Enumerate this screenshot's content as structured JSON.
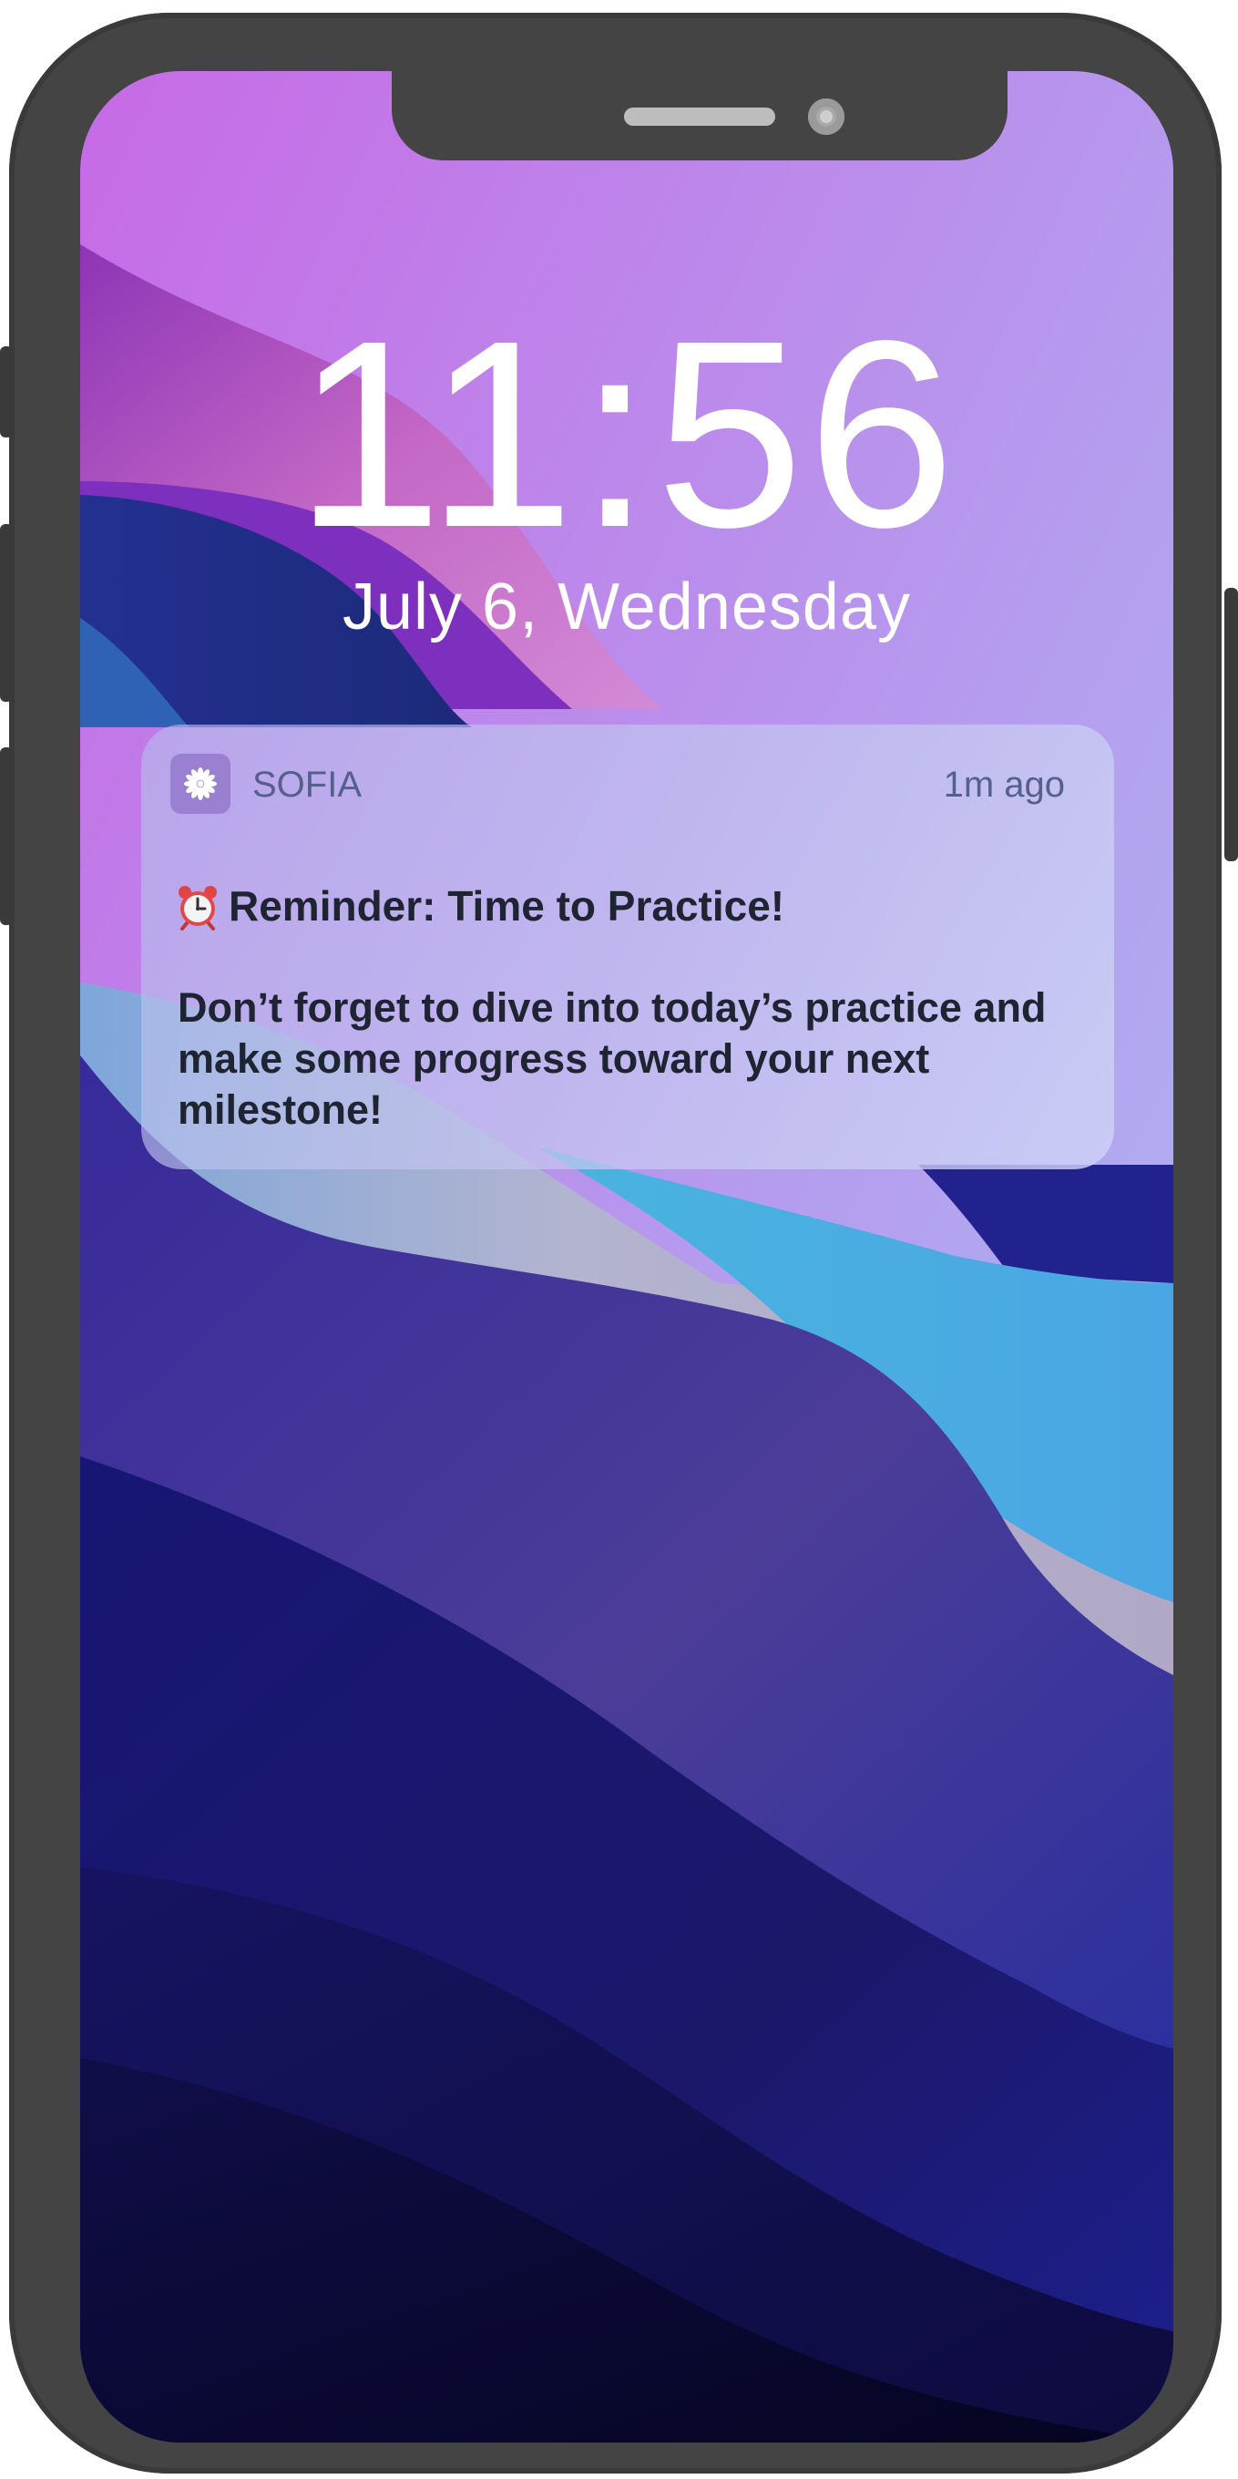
{
  "lock_screen": {
    "time": "11:56",
    "date": "July 6, Wednesday"
  },
  "notification": {
    "app_icon": "flower-icon",
    "app_name": "SOFIA",
    "timestamp": "1m ago",
    "title_icon": "alarm-clock-icon",
    "title": "Reminder: Time to Practice!",
    "body": "Don’t forget to dive into today’s practice and make some progress toward your next milestone!"
  },
  "colors": {
    "phone_frame": "#444444",
    "app_icon_bg": "#9b7fd1",
    "notification_text": "#1f2433",
    "notification_meta_text": "#55608c",
    "clock_text": "#ffffff"
  }
}
